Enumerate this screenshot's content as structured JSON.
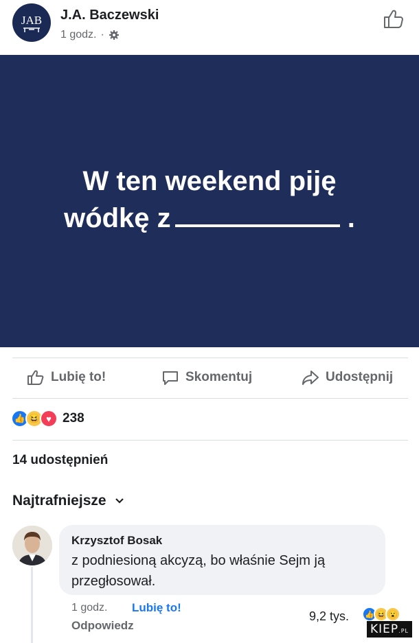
{
  "post": {
    "author": "J.A. Baczewski",
    "time": "1 godz.",
    "separator": "·",
    "logo_text": "JAB",
    "image_line1": "W ten weekend piję",
    "image_line2": "wódkę z",
    "image_line2_end": ".",
    "image_bg": "#1f2d5a"
  },
  "actions": {
    "like": "Lubię to!",
    "comment": "Skomentuj",
    "share": "Udostępnij"
  },
  "reactions": {
    "count": "238",
    "types": [
      "like-icon",
      "haha-icon",
      "love-icon"
    ]
  },
  "shares": "14 udostępnień",
  "sort_label": "Najtrafniejsze",
  "comment": {
    "author": "Krzysztof Bosak",
    "text": "z podniesioną akcyzą, bo właśnie Sejm ją przegłosował.",
    "time": "1 godz.",
    "like_label": "Lubię to!",
    "reply_label": "Odpowiedz",
    "reaction_count": "9,2 tys."
  },
  "watermark": {
    "main": "KIEP",
    "suffix": ".PL"
  },
  "colors": {
    "accent": "#1877f2",
    "muted": "#65676b"
  }
}
